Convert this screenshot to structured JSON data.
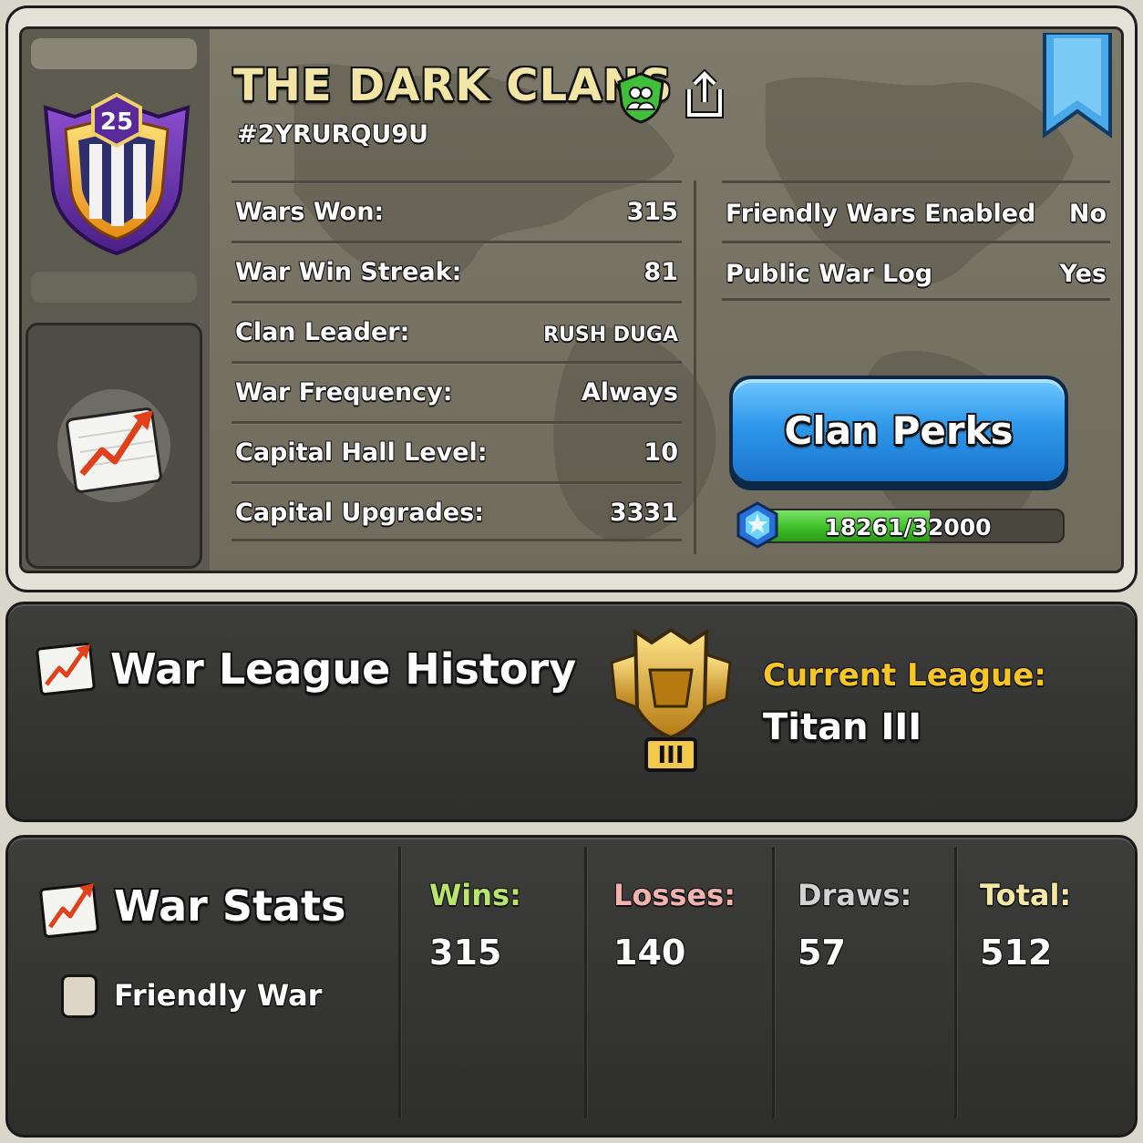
{
  "clan": {
    "name": "THE DARK CLANS",
    "tag": "#2YRURQU9U",
    "level": "25"
  },
  "info_left": [
    {
      "label": "Wars Won:",
      "value": "315"
    },
    {
      "label": "War Win Streak:",
      "value": "81"
    },
    {
      "label": "Clan Leader:",
      "value": "RUSH DUGA"
    },
    {
      "label": "War Frequency:",
      "value": "Always"
    },
    {
      "label": "Capital Hall Level:",
      "value": "10"
    },
    {
      "label": "Capital Upgrades:",
      "value": "3331"
    }
  ],
  "info_right": [
    {
      "label": "Friendly Wars Enabled",
      "value": "No"
    },
    {
      "label": "Public War Log",
      "value": "Yes"
    }
  ],
  "perks": {
    "button_label": "Clan Perks",
    "progress_text": "18261/32000",
    "progress_current": 18261,
    "progress_max": 32000
  },
  "league": {
    "title": "War League History",
    "current_label": "Current League:",
    "current_value": "Titan III",
    "tier_numeral": "III"
  },
  "war_stats": {
    "title": "War Stats",
    "friendly_war_label": "Friendly War",
    "friendly_war_checked": false,
    "columns": [
      {
        "label": "Wins:",
        "value": "315",
        "color": "#b9e66a"
      },
      {
        "label": "Losses:",
        "value": "140",
        "color": "#f2b3b0"
      },
      {
        "label": "Draws:",
        "value": "57",
        "color": "#d2d2d2"
      },
      {
        "label": "Total:",
        "value": "512",
        "color": "#f5e7a4"
      }
    ]
  },
  "colors": {
    "accent_blue": "#2f98ea",
    "league_gold": "#f6c526",
    "clan_name": "#f1e6a6",
    "progress_green": "#3fbf28"
  },
  "icons": {
    "shield": "clan-members-shield-icon",
    "share": "share-icon",
    "bookmark": "bookmark-ribbon-icon",
    "stats": "stats-chart-icon",
    "gem": "capital-gem-icon",
    "trophy": "titan-league-trophy-icon"
  }
}
